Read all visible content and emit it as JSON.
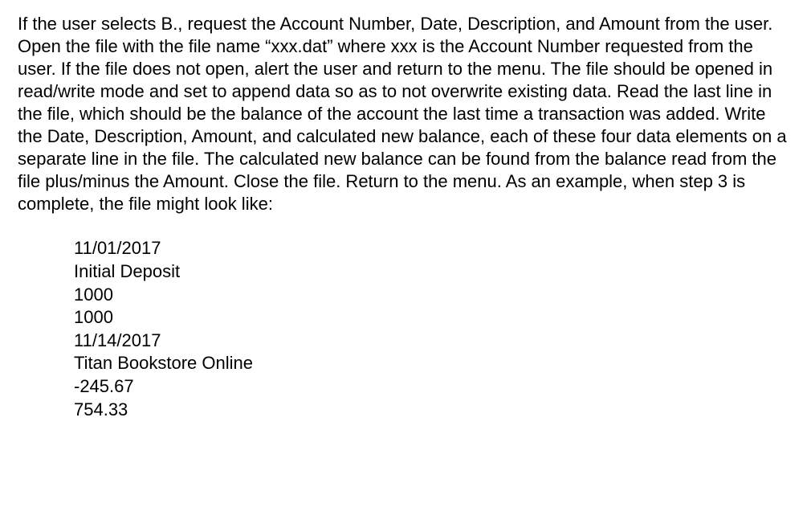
{
  "paragraph": "If the user selects B., request the Account Number, Date, Description, and Amount from the user.  Open the file with the file name “xxx.dat” where xxx is the Account Number requested from the user.  If the file does not open, alert the user and return to the menu.  The file should be opened in read/write mode and set to append data so as to not overwrite existing data.  Read the last line in the file, which should be the balance of the account the last time a transaction was added.  Write the Date, Description, Amount, and calculated new balance, each of these four data elements on a separate line in the file.  The calculated new balance can be found from the balance read from the file plus/minus the Amount.  Close the file.  Return to the menu.  As an example, when step 3 is complete, the file might look like:",
  "example": {
    "lines": [
      "11/01/2017",
      "Initial Deposit",
      "1000",
      "1000",
      "11/14/2017",
      "Titan Bookstore Online",
      "-245.67",
      "754.33"
    ]
  }
}
